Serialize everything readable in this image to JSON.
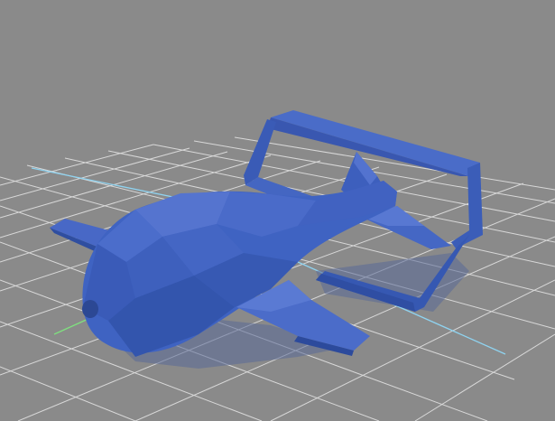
{
  "viewport": {
    "view": "perspective",
    "background_color": "#8a8a8a",
    "grid_color": "#d6d6d6",
    "axis_x_color": "#8fd3f0",
    "axis_y_color": "#7fe07f"
  },
  "model": {
    "name": "airplane",
    "color": "#3f63c2",
    "shadow_color": "#2c4894",
    "highlight_color": "#5d7fd6",
    "selected": false
  }
}
